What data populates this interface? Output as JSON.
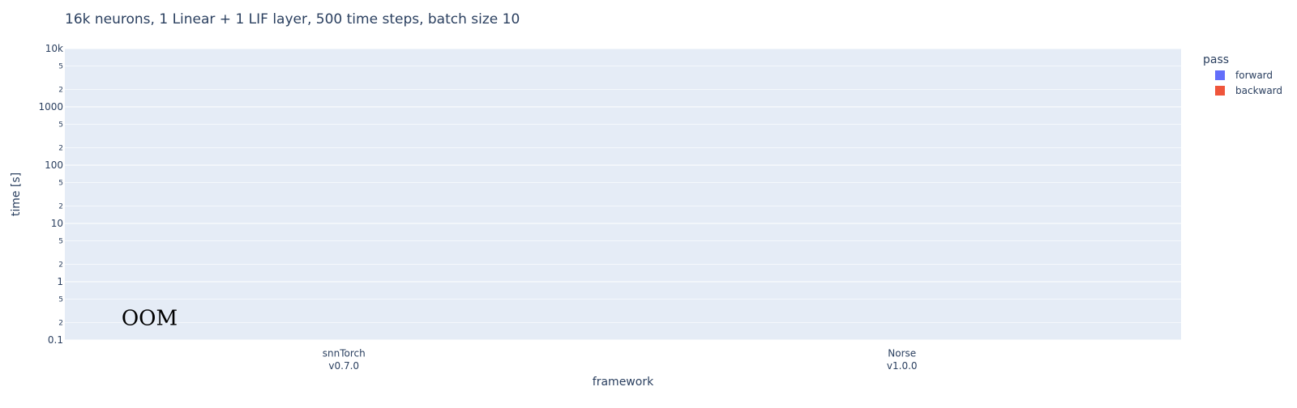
{
  "chart_data": {
    "type": "bar",
    "title": "16k neurons, 1 Linear + 1 LIF layer, 500 time steps, batch size 10",
    "xlabel": "framework",
    "ylabel": "time [s]",
    "y_scale": "log",
    "ylim": [
      0.1,
      10000
    ],
    "grid": true,
    "categories": [
      [
        "snnTorch",
        "v0.7.0"
      ],
      [
        "Norse",
        "v1.0.0"
      ]
    ],
    "y_ticks_major": [
      {
        "value": 10000,
        "label": "10k"
      },
      {
        "value": 1000,
        "label": "1000"
      },
      {
        "value": 100,
        "label": "100"
      },
      {
        "value": 10,
        "label": "10"
      },
      {
        "value": 1,
        "label": "1"
      },
      {
        "value": 0.1,
        "label": "0.1"
      }
    ],
    "y_ticks_minor": [
      {
        "value": 5000,
        "label": "5"
      },
      {
        "value": 2000,
        "label": "2"
      },
      {
        "value": 500,
        "label": "5"
      },
      {
        "value": 200,
        "label": "2"
      },
      {
        "value": 50,
        "label": "5"
      },
      {
        "value": 20,
        "label": "2"
      },
      {
        "value": 5,
        "label": "5"
      },
      {
        "value": 2,
        "label": "2"
      },
      {
        "value": 0.5,
        "label": "5"
      },
      {
        "value": 0.2,
        "label": "2"
      }
    ],
    "legend_title": "pass",
    "legend_position": "top-right",
    "series": [
      {
        "name": "forward",
        "color": "#636efa",
        "values": [
          null,
          null
        ]
      },
      {
        "name": "backward",
        "color": "#ef553b",
        "values": [
          null,
          null
        ]
      }
    ],
    "annotations": [
      {
        "text": "OOM",
        "category_index": 0,
        "y": 0.25
      }
    ],
    "colors": {
      "plot_background": "#e5ecf6",
      "gridline": "#ffffff",
      "text": "#2a3f5f"
    }
  }
}
